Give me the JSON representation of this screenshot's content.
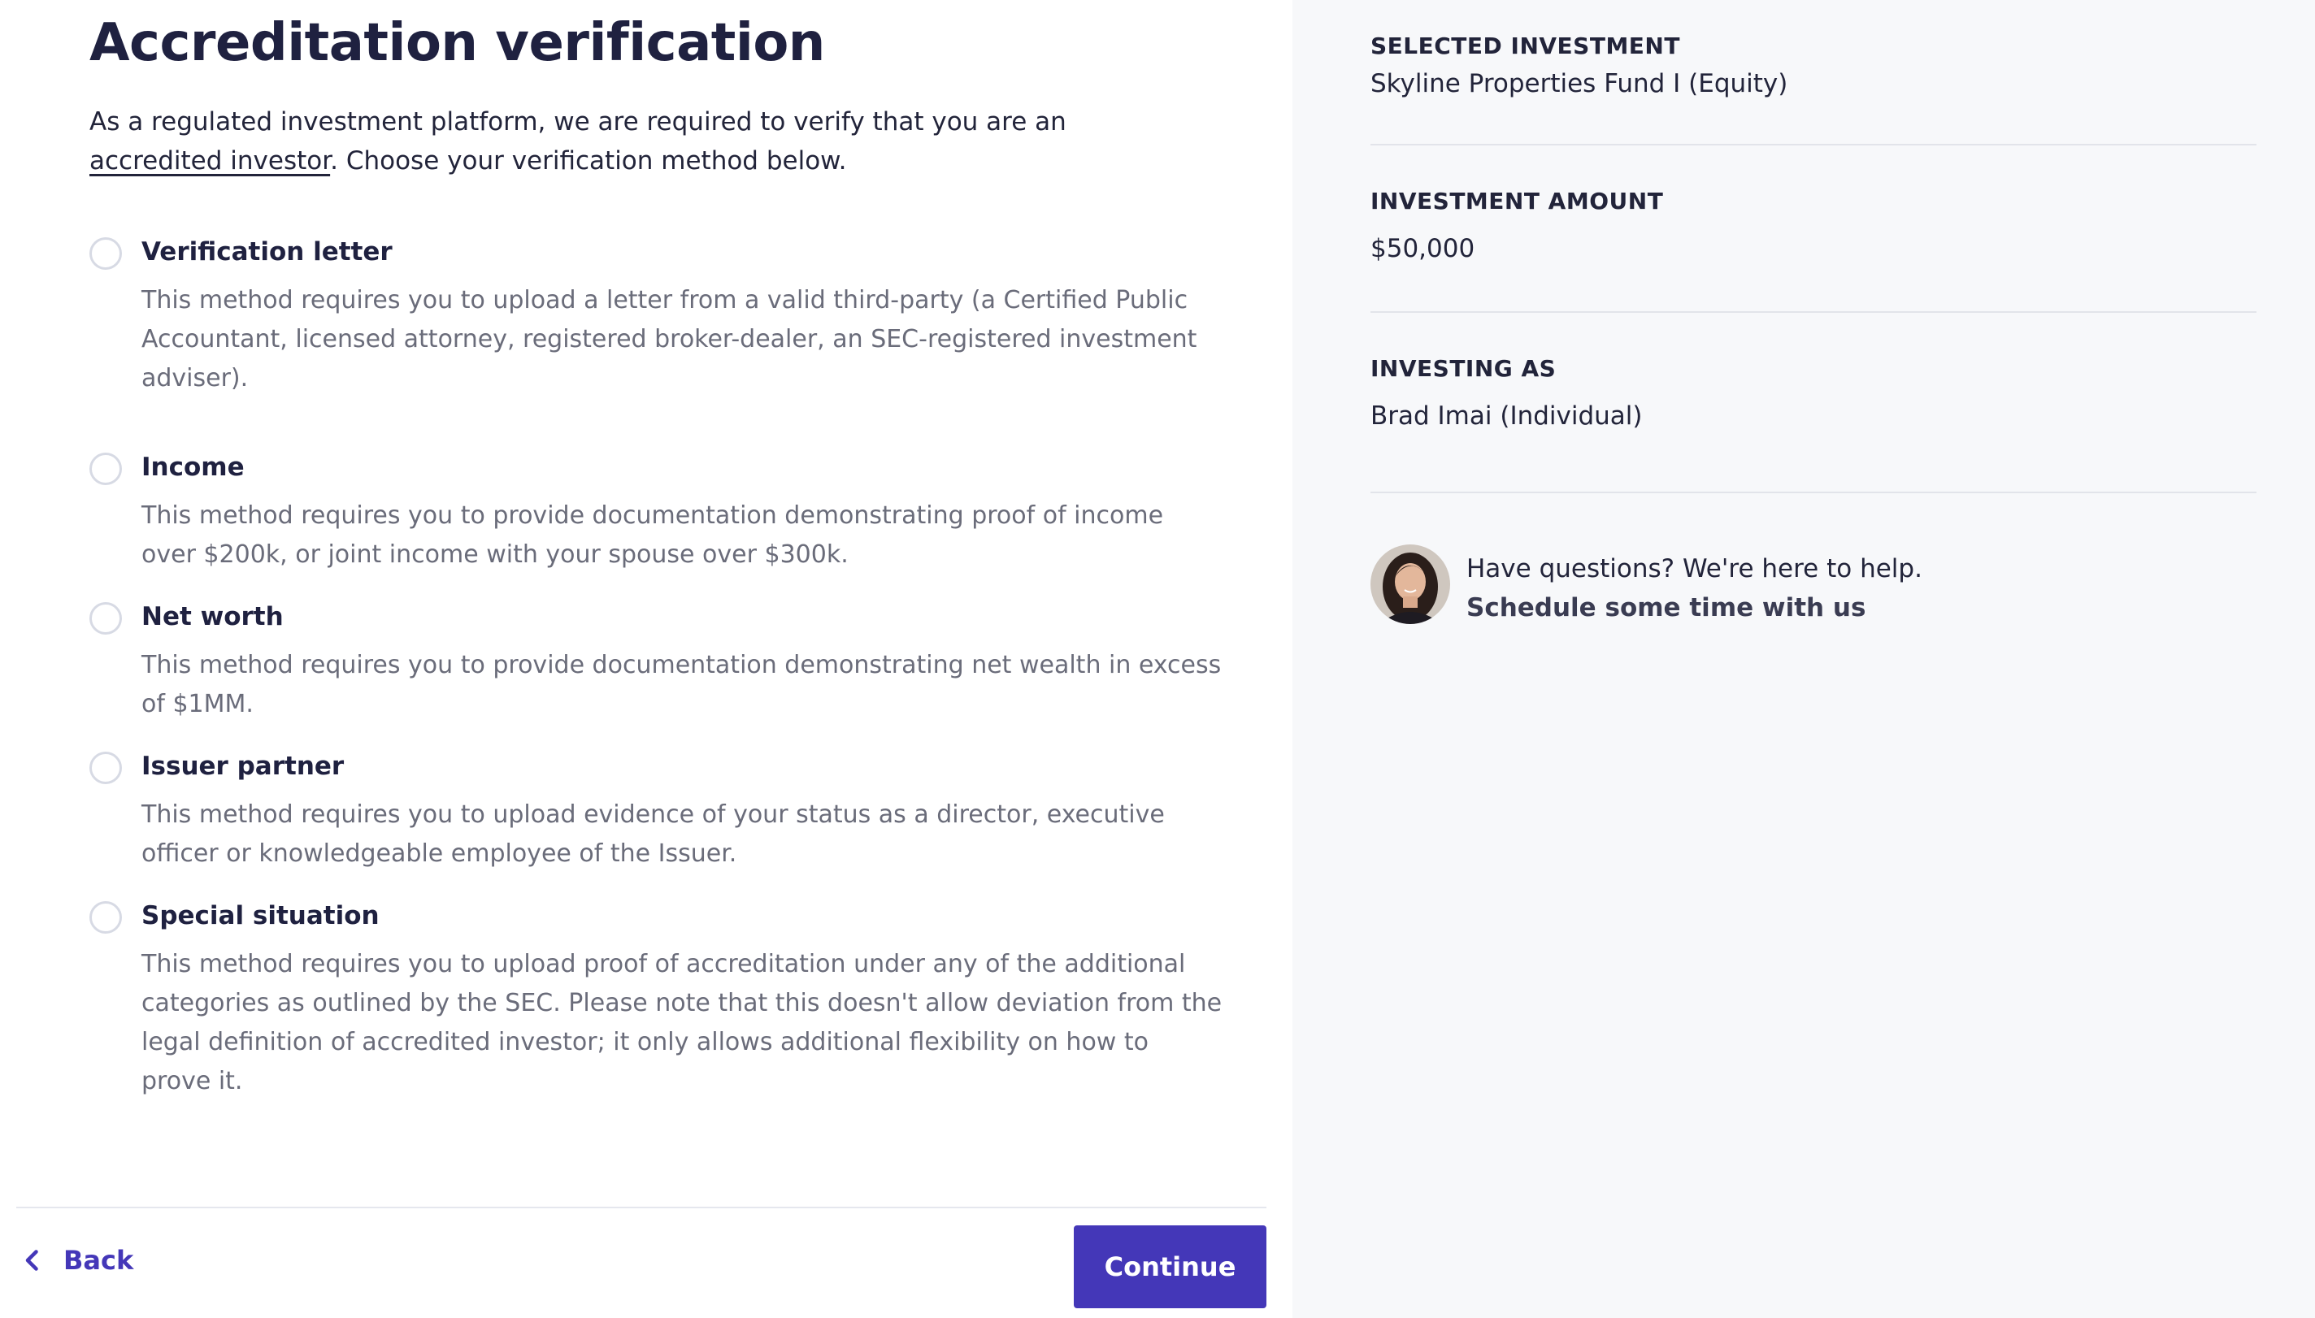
{
  "page": {
    "title": "Accreditation verification",
    "intro_before": "As a regulated investment platform, we are required to verify that you are an ",
    "intro_link": "accredited investor",
    "intro_after": ". Choose your verification method below."
  },
  "options": [
    {
      "label": "Verification letter",
      "description": "This method requires you to upload a letter from a valid third-party (a Certified Public Accountant, licensed attorney, registered broker-dealer, an SEC-registered investment adviser)."
    },
    {
      "label": "Income",
      "description": "This method requires you to provide documentation demonstrating proof of income over $200k, or joint income with your spouse over $300k."
    },
    {
      "label": "Net worth",
      "description": "This method requires you to provide documentation demonstrating net wealth in excess of $1MM."
    },
    {
      "label": "Issuer partner",
      "description": "This method requires you to upload evidence of your status as a director, executive officer or knowledgeable employee of the Issuer."
    },
    {
      "label": "Special situation",
      "description": "This method requires you to upload proof of accreditation under any of the additional categories as outlined by the SEC. Please note that this doesn't allow deviation from the legal definition of accredited investor; it only allows additional flexibility on how to prove it."
    }
  ],
  "footer": {
    "back_label": "Back",
    "continue_label": "Continue"
  },
  "sidebar": {
    "selected_investment_label": "SELECTED INVESTMENT",
    "selected_investment_value": "Skyline Properties Fund I (Equity)",
    "investment_amount_label": "INVESTMENT AMOUNT",
    "investment_amount_value": "$50,000",
    "investing_as_label": "INVESTING AS",
    "investing_as_value": "Brad Imai (Individual)",
    "help_text": "Have questions? We're here to help.",
    "help_link": "Schedule some time with us"
  },
  "colors": {
    "accent": "#4437b8",
    "sidebar_bg": "#f7f8fa",
    "muted_text": "#6a6c7a",
    "heading_text": "#1f2140"
  }
}
